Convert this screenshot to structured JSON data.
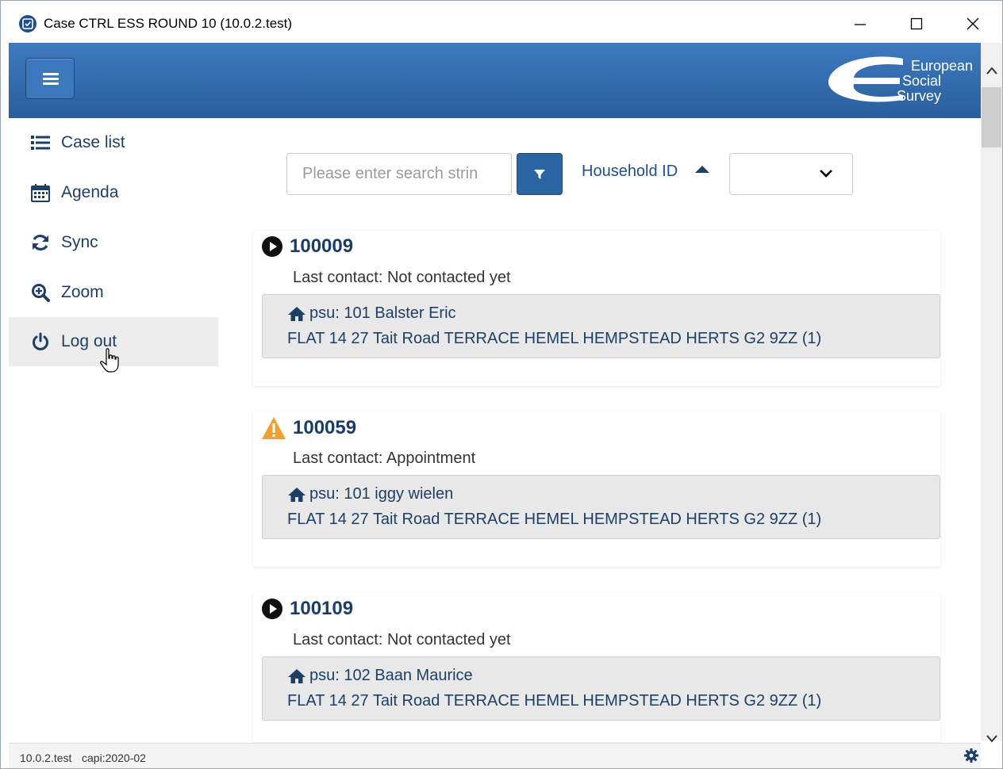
{
  "window": {
    "title": "Case CTRL ESS ROUND 10 (10.0.2.test)"
  },
  "header": {
    "logo_lines": [
      "European",
      "Social",
      "Survey"
    ]
  },
  "sidebar": {
    "items": [
      {
        "label": "Case list",
        "icon": "list-icon"
      },
      {
        "label": "Agenda",
        "icon": "calendar-icon"
      },
      {
        "label": "Sync",
        "icon": "sync-icon"
      },
      {
        "label": "Zoom",
        "icon": "zoom-in-icon"
      },
      {
        "label": "Log out",
        "icon": "power-icon",
        "active": true
      }
    ]
  },
  "search": {
    "placeholder": "Please enter search strin",
    "sort_label": "Household ID",
    "sort_direction": "ascending",
    "select_value": ""
  },
  "cases": [
    {
      "id": "100009",
      "status_icon": "play-circle-icon",
      "last_contact": "Last contact: Not contacted yet",
      "psu": "psu: 101 Balster Eric",
      "address": "FLAT 14 27 Tait Road TERRACE HEMEL HEMPSTEAD HERTS G2 9ZZ (1)"
    },
    {
      "id": "100059",
      "status_icon": "warning-icon",
      "last_contact": "Last contact: Appointment",
      "psu": "psu: 101 iggy wielen",
      "address": "FLAT 14 27 Tait Road TERRACE HEMEL HEMPSTEAD HERTS G2 9ZZ (1)"
    },
    {
      "id": "100109",
      "status_icon": "play-circle-icon",
      "last_contact": "Last contact: Not contacted yet",
      "psu": "psu: 102 Baan Maurice",
      "address": "FLAT 14 27 Tait Road TERRACE HEMEL HEMPSTEAD HERTS G2 9ZZ (1)"
    }
  ],
  "statusbar": {
    "version": "10.0.2.test",
    "capi": "capi:2020-02"
  },
  "colors": {
    "header_blue": "#2a5e9c",
    "accent_blue": "#2a64a2",
    "warning": "#f0a030"
  }
}
